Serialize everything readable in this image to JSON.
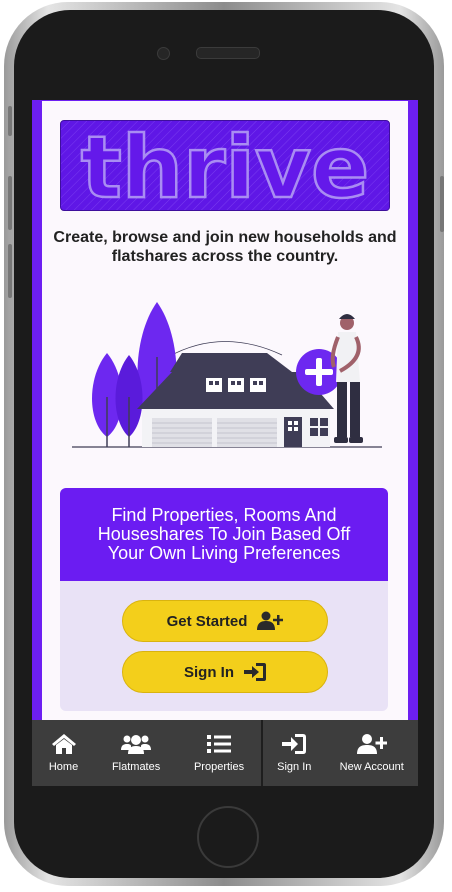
{
  "app": {
    "logo_text": "thrive",
    "tagline": "Create, browse and join new households and flatshares across the country."
  },
  "promo": {
    "heading": "Find Properties, Rooms And Houseshares To Join Based Off Your Own Living Preferences"
  },
  "actions": {
    "get_started_label": "Get Started",
    "sign_in_label": "Sign In"
  },
  "nav": {
    "items": [
      {
        "label": "Home",
        "icon": "home-icon"
      },
      {
        "label": "Flatmates",
        "icon": "users-icon"
      },
      {
        "label": "Properties",
        "icon": "list-icon"
      },
      {
        "label": "Sign In",
        "icon": "sign-in-icon"
      },
      {
        "label": "New Account",
        "icon": "user-plus-icon"
      }
    ]
  },
  "colors": {
    "brand_purple": "#6b1cf2",
    "accent_yellow": "#f3cf1b",
    "nav_background": "#3d3d3d"
  }
}
